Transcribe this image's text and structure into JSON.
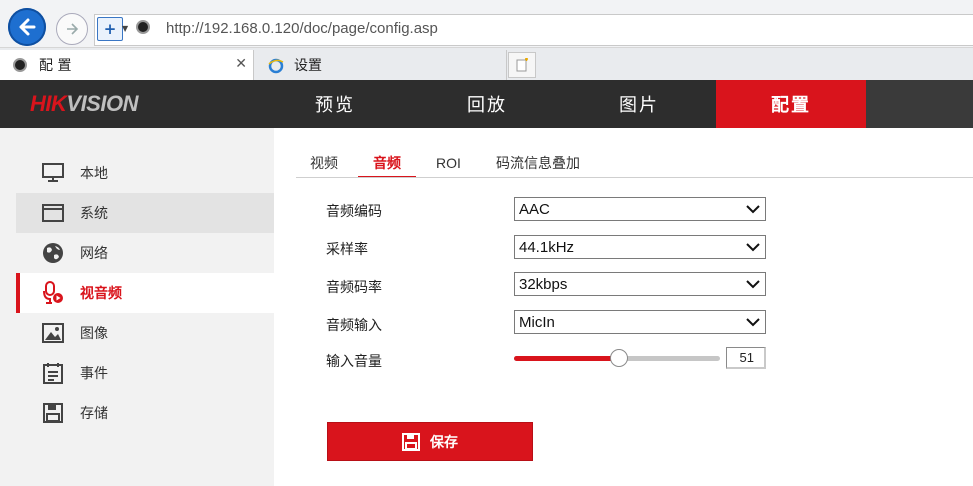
{
  "browser": {
    "url": "http://192.168.0.120/doc/page/config.asp",
    "tabs": [
      {
        "label": "配 置",
        "active": true
      },
      {
        "label": "设置",
        "active": false
      }
    ]
  },
  "brand": {
    "logo_part1": "HIK",
    "logo_part2": "VISION",
    "accent": "#d9141c"
  },
  "nav": {
    "items": [
      {
        "label": "预览",
        "active": false
      },
      {
        "label": "回放",
        "active": false
      },
      {
        "label": "图片",
        "active": false
      },
      {
        "label": "配置",
        "active": true
      }
    ]
  },
  "sidebar": {
    "items": [
      {
        "label": "本地",
        "icon": "monitor-icon"
      },
      {
        "label": "系统",
        "icon": "window-icon"
      },
      {
        "label": "网络",
        "icon": "globe-icon"
      },
      {
        "label": "视音频",
        "icon": "mic-icon",
        "active": true
      },
      {
        "label": "图像",
        "icon": "image-icon"
      },
      {
        "label": "事件",
        "icon": "list-icon"
      },
      {
        "label": "存储",
        "icon": "floppy-icon"
      }
    ]
  },
  "subtabs": {
    "items": [
      {
        "label": "视频"
      },
      {
        "label": "音频",
        "active": true
      },
      {
        "label": "ROI"
      },
      {
        "label": "码流信息叠加"
      }
    ]
  },
  "form": {
    "audio_encoding": {
      "label": "音频编码",
      "value": "AAC"
    },
    "sample_rate": {
      "label": "采样率",
      "value": "44.1kHz"
    },
    "audio_bitrate": {
      "label": "音频码率",
      "value": "32kbps"
    },
    "audio_input": {
      "label": "音频输入",
      "value": "MicIn"
    },
    "input_volume": {
      "label": "输入音量",
      "value": "51",
      "level_fraction": 0.51
    }
  },
  "save_label": "保存"
}
